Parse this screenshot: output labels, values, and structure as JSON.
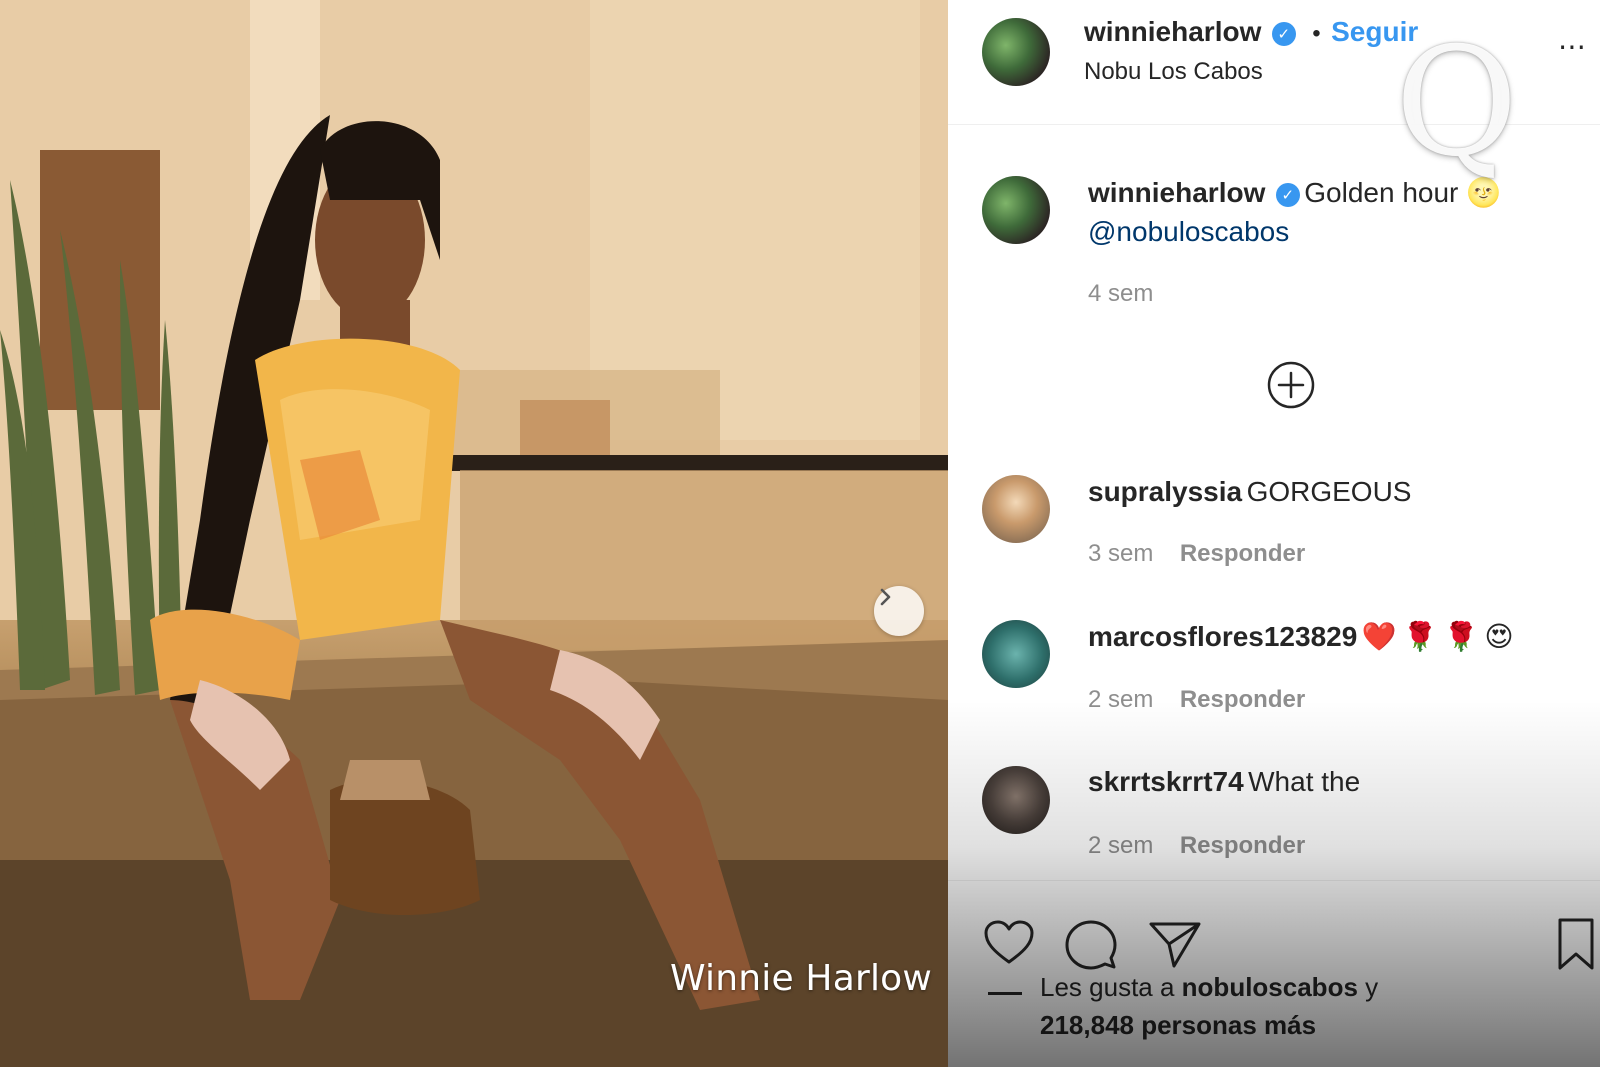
{
  "photo": {
    "caption": "Winnie Harlow",
    "next_icon": "chevron-right-icon"
  },
  "header": {
    "username": "winnieharlow",
    "verified_icon": "verified-badge-icon",
    "dot": "•",
    "follow_label": "Seguir",
    "location": "Nobu Los Cabos",
    "more_icon": "more-options-icon"
  },
  "caption": {
    "username": "winnieharlow",
    "text": "Golden hour 🌝",
    "mention": "@nobuloscabos",
    "time": "4 sem"
  },
  "load_more_icon": "plus-circle-icon",
  "comments": [
    {
      "username": "supralyssia",
      "text": "GORGEOUS",
      "time": "3 sem",
      "reply": "Responder"
    },
    {
      "username": "marcosflores123829",
      "text": "❤️🌹🌹😍",
      "time": "2 sem",
      "reply": "Responder"
    },
    {
      "username": "skrrtskrrt74",
      "text": "What the",
      "time": "2 sem",
      "reply": "Responder"
    }
  ],
  "actions": {
    "like_icon": "heart-icon",
    "comment_icon": "comment-icon",
    "share_icon": "send-icon",
    "save_icon": "bookmark-icon"
  },
  "likes": {
    "prefix": "Les gusta a",
    "user": "nobuloscabos",
    "middle": "y",
    "count": "218,848 personas más"
  },
  "watermark": "Q",
  "colors": {
    "link_blue": "#3897f0",
    "text": "#262626",
    "secondary": "#8e8e8e"
  }
}
